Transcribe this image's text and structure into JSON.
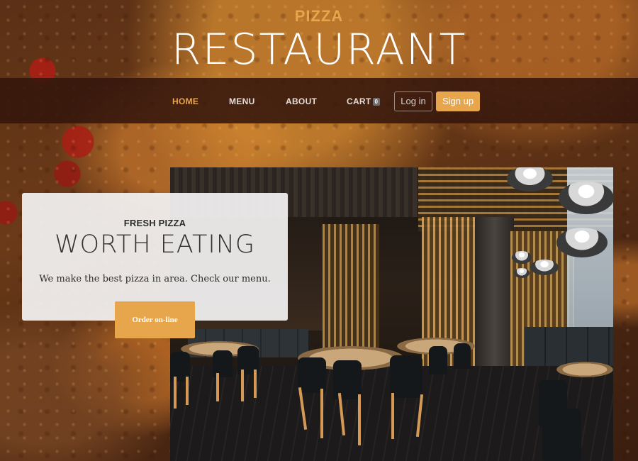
{
  "brand": {
    "small": "PIZZA",
    "large": "RESTAURANT"
  },
  "nav": {
    "home": "HOME",
    "menu": "MENU",
    "about": "ABOUT",
    "cart": "CART",
    "cart_count": "0",
    "login": "Log in",
    "signup": "Sign up"
  },
  "hero": {
    "kicker": "FRESH PIZZA",
    "title": "WORTH EATING",
    "text": "We make the best pizza in area. Check our menu.",
    "cta": "Order on-line"
  },
  "colors": {
    "accent": "#e8a64c",
    "navbar": "#34160c",
    "card": "#f3f2f2"
  },
  "images": {
    "background": "pizza-background",
    "hero_photo": "restaurant-interior-photo"
  }
}
